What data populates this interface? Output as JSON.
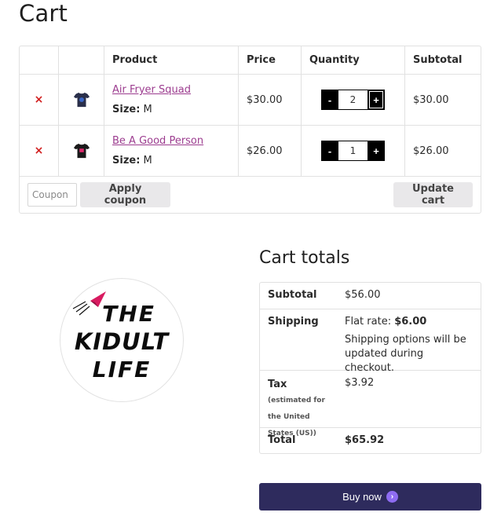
{
  "page": {
    "title": "Cart"
  },
  "table": {
    "headers": {
      "product": "Product",
      "price": "Price",
      "quantity": "Quantity",
      "subtotal": "Subtotal"
    },
    "items": [
      {
        "name": "Air Fryer Squad",
        "size_label": "Size:",
        "size": "M",
        "price": "$30.00",
        "quantity": "2",
        "subtotal": "$30.00",
        "shirt_color": "#2a2f4a",
        "print_color": "#3a66c8"
      },
      {
        "name": "Be A Good Person",
        "size_label": "Size:",
        "size": "M",
        "price": "$26.00",
        "quantity": "1",
        "subtotal": "$26.00",
        "shirt_color": "#1a1a1a",
        "print_color": "#e0286c"
      }
    ],
    "remove_symbol": "×",
    "minus": "-",
    "plus": "+",
    "coupon_placeholder": "Coupon",
    "apply_coupon": "Apply coupon",
    "update_cart": "Update cart"
  },
  "logo": {
    "line1": "THE",
    "line2": "KIDULT",
    "line3": "LIFE",
    "accent": "#d81b60"
  },
  "totals": {
    "title": "Cart totals",
    "subtotal_label": "Subtotal",
    "subtotal_value": "$56.00",
    "shipping_label": "Shipping",
    "shipping_prefix": "Flat rate:",
    "shipping_amount": "$6.00",
    "shipping_note": "Shipping options will be updated during checkout.",
    "tax_label": "Tax",
    "tax_note": "(estimated for the United States (US))",
    "tax_value": "$3.92",
    "total_label": "Total",
    "total_value": "$65.92"
  },
  "buy": {
    "label": "Buy now",
    "icon": "chevron-right-icon"
  },
  "colors": {
    "link": "#9c3c8f",
    "remove": "#d11f1f",
    "buy_bg": "#2e2b5d",
    "buy_icon": "#8e6cf2"
  }
}
